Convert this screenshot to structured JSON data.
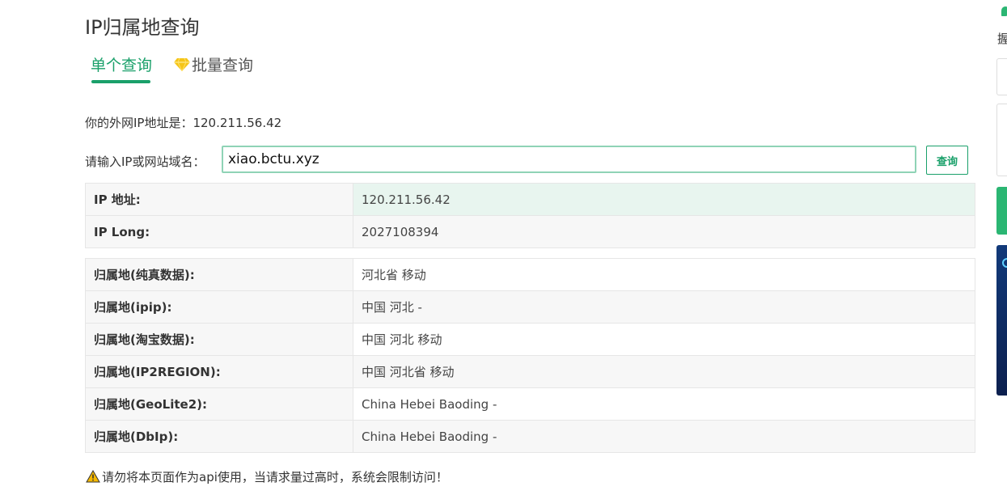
{
  "page": {
    "title": "IP归属地查询"
  },
  "tabs": [
    {
      "label": "单个查询",
      "active": true
    },
    {
      "label": "批量查询",
      "active": false,
      "icon": "diamond-icon"
    }
  ],
  "your_ip": "你的外网IP地址是：120.211.56.42",
  "query": {
    "label": "请输入IP或网站域名：",
    "value": "xiao.bctu.xyz",
    "button": "查询"
  },
  "basic": [
    {
      "key": "IP 地址:",
      "value": "120.211.56.42"
    },
    {
      "key": "IP Long:",
      "value": "2027108394"
    }
  ],
  "locations": [
    {
      "key": "归属地(纯真数据):",
      "value": "河北省 移动"
    },
    {
      "key": "归属地(ipip):",
      "value": "中国 河北 -"
    },
    {
      "key": "归属地(淘宝数据):",
      "value": "中国 河北 移动"
    },
    {
      "key": "归属地(IP2REGION):",
      "value": "中国 河北省 移动"
    },
    {
      "key": "归属地(GeoLite2):",
      "value": "China Hebei Baoding -"
    },
    {
      "key": "归属地(DbIp):",
      "value": "China Hebei Baoding -"
    }
  ],
  "warning": "请勿将本页面作为api使用，当请求量过高时，系统会限制访问！",
  "sidebar": {
    "glyph": "握"
  },
  "colors": {
    "accent": "#1aa06a",
    "highlight_row": "#e8f5ef",
    "warning_icon": "#f5b800",
    "diamond": "#f5c518"
  }
}
